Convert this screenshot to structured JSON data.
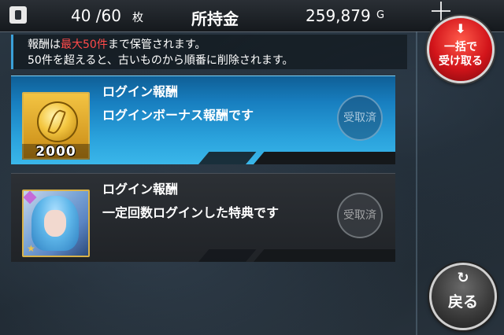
{
  "header": {
    "count": "40 /60",
    "count_unit": "枚",
    "money_label": "所持金",
    "money": "259,879",
    "money_unit": "G"
  },
  "notice": {
    "line1_pre": "報酬は",
    "line1_hl": "最大50件",
    "line1_post": "まで保管されます。",
    "line2": "50件を超えると、古いものから順番に削除されます。"
  },
  "rewards": [
    {
      "title": "ログイン報酬",
      "description": "ログインボーナス報酬です",
      "item_label": "2000",
      "status": "受取済",
      "icon": "gold-coin-icon"
    },
    {
      "title": "ログイン報酬",
      "description": "一定回数ログインした特典です",
      "status": "受取済",
      "icon": "character-portrait"
    }
  ],
  "buttons": {
    "claim_all_line1": "一括で",
    "claim_all_line2": "受け取る",
    "back": "戻る"
  },
  "colors": {
    "accent_red": "#d2141a",
    "highlight_text": "#ff4a4a",
    "active_card": "#2aa2dc"
  }
}
